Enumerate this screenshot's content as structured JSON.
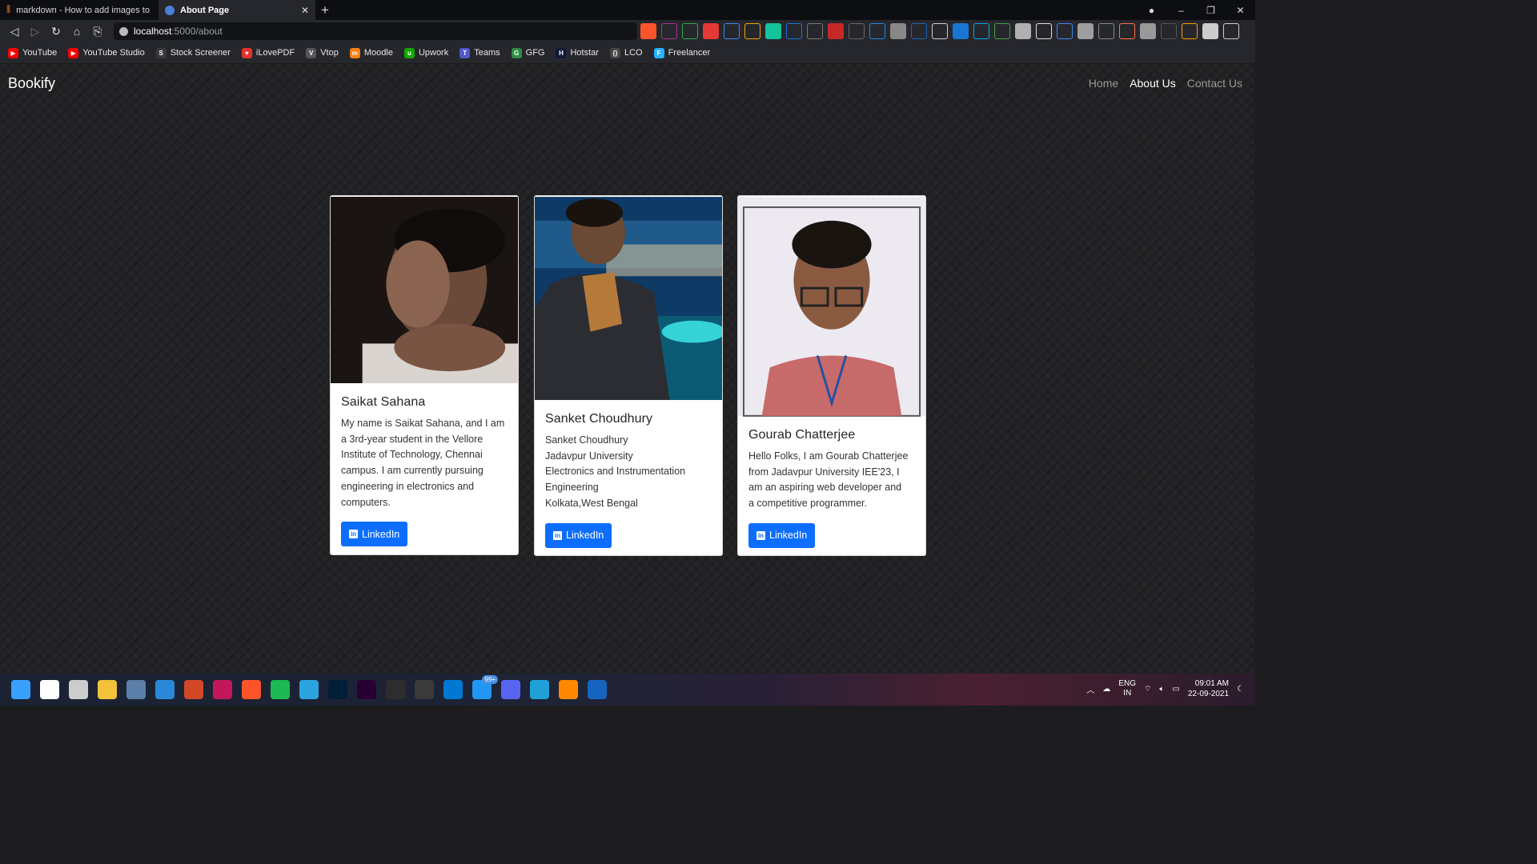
{
  "browser": {
    "tabs": [
      {
        "title": "markdown - How to add images to RE",
        "active": false
      },
      {
        "title": "About Page",
        "active": true
      }
    ],
    "new_tab_glyph": "+",
    "close_glyph": "✕",
    "url_domain": "localhost",
    "url_path": ":5000/about",
    "window_controls": [
      "–",
      "❐",
      "✕"
    ]
  },
  "bookmarks": [
    {
      "label": "YouTube",
      "icon": "youtube-icon",
      "color": "#ff0000",
      "glyph": "▶"
    },
    {
      "label": "YouTube Studio",
      "icon": "youtube-studio-icon",
      "color": "#ff0000",
      "glyph": "▶"
    },
    {
      "label": "Stock Screener",
      "icon": "stock-screener-icon",
      "color": "#3a3a3a",
      "glyph": "S"
    },
    {
      "label": "iLovePDF",
      "icon": "ilovepdf-icon",
      "color": "#e5322d",
      "glyph": "♥"
    },
    {
      "label": "Vtop",
      "icon": "vtop-icon",
      "color": "#555555",
      "glyph": "V"
    },
    {
      "label": "Moodle",
      "icon": "moodle-icon",
      "color": "#f98012",
      "glyph": "m"
    },
    {
      "label": "Upwork",
      "icon": "upwork-icon",
      "color": "#14a800",
      "glyph": "u"
    },
    {
      "label": "Teams",
      "icon": "teams-icon",
      "color": "#5059c9",
      "glyph": "T"
    },
    {
      "label": "GFG",
      "icon": "gfg-icon",
      "color": "#2f8d46",
      "glyph": "G"
    },
    {
      "label": "Hotstar",
      "icon": "hotstar-icon",
      "color": "#0f1a3c",
      "glyph": "H"
    },
    {
      "label": "LCO",
      "icon": "lco-icon",
      "color": "#444444",
      "glyph": "{}"
    },
    {
      "label": "Freelancer",
      "icon": "freelancer-icon",
      "color": "#29b2fe",
      "glyph": "F"
    }
  ],
  "extensions": [
    {
      "icon": "brave-shield-icon",
      "color": "#fb542b"
    },
    {
      "icon": "brave-rewards-icon",
      "color": "#b02e8e"
    },
    {
      "icon": "plus-ext-icon",
      "color": "#34a853"
    },
    {
      "icon": "red-ext-icon",
      "color": "#e53935"
    },
    {
      "icon": "blue-ext-icon",
      "color": "#4285f4"
    },
    {
      "icon": "grammarly-g-icon",
      "color": "#f4a400"
    },
    {
      "icon": "grammarly-icon",
      "color": "#15c39a"
    },
    {
      "icon": "s-ext-icon",
      "color": "#1a73e8"
    },
    {
      "icon": "gray-ext-icon",
      "color": "#777777"
    },
    {
      "icon": "k-ext-icon",
      "color": "#c62828"
    },
    {
      "icon": "rocket-ext-icon",
      "color": "#666666"
    },
    {
      "icon": "iq-ext-icon",
      "color": "#1e88e5"
    },
    {
      "icon": "record-ext-icon",
      "color": "#888888"
    },
    {
      "icon": "wave-ext-icon",
      "color": "#1565c0"
    },
    {
      "icon": "menu-ext-icon",
      "color": "#cccccc"
    },
    {
      "icon": "dictionary-ext-icon",
      "color": "#1976d2"
    },
    {
      "icon": "s-blue-ext-icon",
      "color": "#03a9f4"
    },
    {
      "icon": "green-ext-icon",
      "color": "#43a047"
    },
    {
      "icon": "screenshot-ext-icon",
      "color": "#b0b0b0"
    },
    {
      "icon": "table-ext-icon",
      "color": "#dddddd"
    },
    {
      "icon": "translate-ext-icon",
      "color": "#4285f4"
    },
    {
      "icon": "chrome-ext-icon",
      "color": "#9e9e9e"
    },
    {
      "icon": "image-ext-icon",
      "color": "#888888"
    },
    {
      "icon": "color-ext-icon",
      "color": "#ff7043"
    },
    {
      "icon": "ghost-ext-icon",
      "color": "#999999"
    },
    {
      "icon": "radio-ext-icon",
      "color": "#555555"
    },
    {
      "icon": "orange-ext-icon",
      "color": "#ff9800"
    },
    {
      "icon": "puzzle-icon",
      "color": "#cccccc"
    },
    {
      "icon": "menu-icon",
      "color": "#cccccc"
    }
  ],
  "site": {
    "brand": "Bookify",
    "nav": [
      {
        "label": "Home",
        "active": false
      },
      {
        "label": "About Us",
        "active": true
      },
      {
        "label": "Contact Us",
        "active": false
      }
    ]
  },
  "cards": [
    {
      "name": "Saikat Sahana",
      "desc_lines": [
        "My name is Saikat Sahana, and I am",
        "a 3rd-year student in the Vellore",
        "Institute of Technology, Chennai",
        "campus. I am currently pursuing",
        "engineering in electronics and",
        "computers."
      ],
      "button": "LinkedIn",
      "photo_bg": "#1a1412"
    },
    {
      "name": "Sanket Choudhury",
      "desc_lines": [
        "Sanket Choudhury",
        "Jadavpur University",
        "Electronics and Instrumentation",
        "Engineering",
        "Kolkata,West Bengal"
      ],
      "button": "LinkedIn",
      "photo_bg": "#0e3a66"
    },
    {
      "name": "Gourab Chatterjee",
      "desc_lines": [
        "Hello Folks, I am Gourab Chatterjee",
        "from Jadavpur University IEE'23, I",
        "am an aspiring web developer and",
        "a competitive programmer."
      ],
      "button": "LinkedIn",
      "photo_bg": "#ece9f1"
    }
  ],
  "taskbar": {
    "apps": [
      {
        "icon": "windows-start-icon",
        "color": "#3aa0ff"
      },
      {
        "icon": "search-icon",
        "color": "#ffffff"
      },
      {
        "icon": "task-view-icon",
        "color": "#cccccc"
      },
      {
        "icon": "file-explorer-icon",
        "color": "#f3c13a"
      },
      {
        "icon": "calculator-icon",
        "color": "#5b7fa8"
      },
      {
        "icon": "mail-icon",
        "color": "#2b88d8"
      },
      {
        "icon": "powerpoint-p-icon",
        "color": "#d24726"
      },
      {
        "icon": "snip-icon",
        "color": "#c2185b"
      },
      {
        "icon": "brave-icon",
        "color": "#fb542b"
      },
      {
        "icon": "spotify-icon",
        "color": "#1db954"
      },
      {
        "icon": "telegram-icon",
        "color": "#2aa3df"
      },
      {
        "icon": "photoshop-icon",
        "color": "#001e36"
      },
      {
        "icon": "premiere-icon",
        "color": "#2a0033"
      },
      {
        "icon": "terminal-icon",
        "color": "#2d2d2d"
      },
      {
        "icon": "obs-icon",
        "color": "#3a3a3a"
      },
      {
        "icon": "vscode-icon",
        "color": "#0078d4"
      },
      {
        "icon": "chat-badge-icon",
        "color": "#2196f3"
      },
      {
        "icon": "discord-icon",
        "color": "#5865f2"
      },
      {
        "icon": "edge-icon",
        "color": "#1fa0d6"
      },
      {
        "icon": "vlc-icon",
        "color": "#ff8800"
      },
      {
        "icon": "app-w-icon",
        "color": "#1565c0"
      }
    ],
    "badge": "99+",
    "tray": {
      "lang_top": "ENG",
      "lang_bottom": "IN",
      "time": "09:01 AM",
      "date": "22-09-2021"
    }
  }
}
